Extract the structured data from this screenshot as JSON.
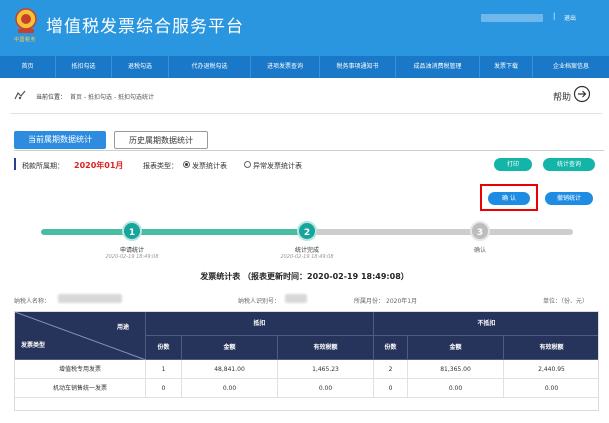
{
  "header": {
    "logo_subtitle": "中国税务",
    "title": "增值税发票综合服务平台",
    "separator": "|",
    "logout": "退出",
    "brand_color": "#2a96e0"
  },
  "nav": [
    {
      "label": "首页"
    },
    {
      "label": "抵扣勾选"
    },
    {
      "label": "退税勾选"
    },
    {
      "label": "代办退税勾选"
    },
    {
      "label": "进项发票查询"
    },
    {
      "label": "税务事项通知书"
    },
    {
      "label": "成品油消费税管理"
    },
    {
      "label": "发票下载"
    },
    {
      "label": "企业档案信息"
    }
  ],
  "breadcrumb": {
    "label": "当前位置：",
    "path": "首页 - 抵扣勾选 - 抵扣勾选统计",
    "help": "帮助"
  },
  "tabs": {
    "current": "当前属期数据统计",
    "history": "历史属期数据统计"
  },
  "period": {
    "label": "税款所属期：",
    "value": "2020年01月",
    "report_type_label": "报表类型：",
    "option_normal": "发票统计表",
    "option_abnormal": "异常发票统计表",
    "selected": "发票统计表"
  },
  "buttons": {
    "print": "打印",
    "stats_query": "统计查询",
    "confirm": "确 认",
    "revoke": "撤销统计",
    "accent_green": "#12b5a8",
    "accent_blue": "#1e8ce3",
    "highlight_red": "#e00000"
  },
  "steps": [
    {
      "number": "1",
      "label": "申请统计",
      "time": "2020-02-19 18:49:08",
      "done": true
    },
    {
      "number": "2",
      "label": "统计完成",
      "time": "2020-02-19 18:49:08",
      "done": true
    },
    {
      "number": "3",
      "label": "确认",
      "time": "",
      "done": false
    }
  ],
  "report": {
    "title": "发票统计表 （报表更新时间：2020-02-19 18:49:08）"
  },
  "meta": {
    "taxpayer_name_label": "纳税人名称：",
    "taxpayer_id_label": "纳税人识别号：",
    "period_label": "所属月份：",
    "period_value": "2020年1月",
    "unit": "单位：（份、元）"
  },
  "table": {
    "header": {
      "invoice_type": "发票类型",
      "usage": "用途",
      "deduct": "抵扣",
      "no_deduct": "不抵扣",
      "count": "份数",
      "amount": "金额",
      "valid_tax": "有效税额"
    },
    "rows": [
      {
        "type": "增值税专用发票",
        "d_count": "1",
        "d_amount": "48,841.00",
        "d_tax": "1,465.23",
        "n_count": "2",
        "n_amount": "81,365.00",
        "n_tax": "2,440.95"
      },
      {
        "type": "机动车销售统一发票",
        "d_count": "0",
        "d_amount": "0.00",
        "d_tax": "0.00",
        "n_count": "0",
        "n_amount": "0.00",
        "n_tax": "0.00"
      }
    ]
  }
}
